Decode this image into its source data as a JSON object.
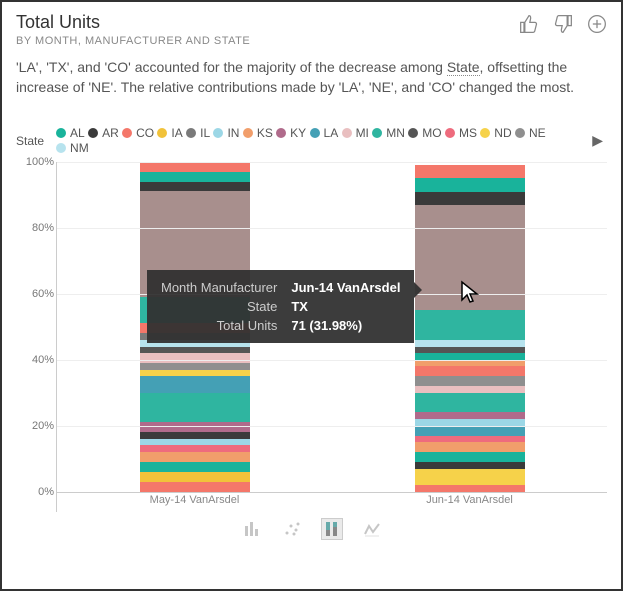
{
  "header": {
    "title": "Total Units",
    "subtitle": "BY MONTH, MANUFACTURER AND STATE"
  },
  "insight": {
    "pre": "'LA', 'TX', and 'CO' accounted for the majority of the decrease among ",
    "link": "State",
    "post": ", offsetting the increase of 'NE'. The relative contributions made by 'LA', 'NE', and 'CO' changed the most."
  },
  "legend": {
    "label": "State",
    "items": [
      {
        "name": "AL",
        "color": "#19b39b"
      },
      {
        "name": "AR",
        "color": "#3a3a3a"
      },
      {
        "name": "CO",
        "color": "#f4776a"
      },
      {
        "name": "IA",
        "color": "#f1c23a"
      },
      {
        "name": "IL",
        "color": "#7a7a7a"
      },
      {
        "name": "IN",
        "color": "#9cd7e6"
      },
      {
        "name": "KS",
        "color": "#f19e6b"
      },
      {
        "name": "KY",
        "color": "#b06b8b"
      },
      {
        "name": "LA",
        "color": "#44a0b5"
      },
      {
        "name": "MI",
        "color": "#e9bfc0"
      },
      {
        "name": "MN",
        "color": "#2fb5a0"
      },
      {
        "name": "MO",
        "color": "#555555"
      },
      {
        "name": "MS",
        "color": "#ee6b7d"
      },
      {
        "name": "ND",
        "color": "#f6d24a"
      },
      {
        "name": "NE",
        "color": "#8f8f8f"
      },
      {
        "name": "NM",
        "color": "#b7e3ee"
      }
    ]
  },
  "tooltip": {
    "k1": "Month Manufacturer",
    "v1": "Jun-14 VanArsdel",
    "k2": "State",
    "v2": "TX",
    "k3": "Total Units",
    "v3": "71 (31.98%)"
  },
  "viewbuttons": {
    "active_index": 2
  },
  "chart_data": {
    "type": "bar",
    "stacked": "100%",
    "ylabel": "",
    "xlabel": "",
    "ylim": [
      0,
      100
    ],
    "y_ticks": [
      "0%",
      "20%",
      "40%",
      "60%",
      "80%",
      "100%"
    ],
    "categories": [
      "May-14 VanArsdel",
      "Jun-14 VanArsdel"
    ],
    "legend_dimension": "State",
    "series_listed": [
      "AL",
      "AR",
      "CO",
      "IA",
      "IL",
      "IN",
      "KS",
      "KY",
      "LA",
      "MI",
      "MN",
      "MO",
      "MS",
      "ND",
      "NE",
      "NM"
    ],
    "segments": [
      [
        {
          "color": "#f4776a",
          "pct": 3.0
        },
        {
          "color": "#f1c23a",
          "pct": 3.0
        },
        {
          "color": "#19b39b",
          "pct": 3.0
        },
        {
          "color": "#f19e6b",
          "pct": 3.0
        },
        {
          "color": "#ee6b7d",
          "pct": 2.0
        },
        {
          "color": "#9cd7e6",
          "pct": 2.0
        },
        {
          "color": "#3a3a3a",
          "pct": 2.0
        },
        {
          "color": "#b06b8b",
          "pct": 3.0
        },
        {
          "color": "#2fb5a0",
          "pct": 9.0
        },
        {
          "color": "#44a0b5",
          "pct": 5.0
        },
        {
          "color": "#f6d24a",
          "pct": 2.0
        },
        {
          "color": "#8f8f8f",
          "pct": 2.0
        },
        {
          "color": "#e9bfc0",
          "pct": 3.0
        },
        {
          "color": "#555555",
          "pct": 2.0
        },
        {
          "color": "#b7e3ee",
          "pct": 2.0
        },
        {
          "color": "#7a7a7a",
          "pct": 2.0
        },
        {
          "color": "#f4776a",
          "pct": 3.0
        },
        {
          "color": "#2fb5a0",
          "pct": 8.0
        },
        {
          "color": "#a88f8d",
          "pct": 32.0
        },
        {
          "color": "#3a3a3a",
          "pct": 3.0
        },
        {
          "color": "#19b39b",
          "pct": 3.0
        },
        {
          "color": "#f4776a",
          "pct": 3.0
        }
      ],
      [
        {
          "color": "#f4776a",
          "pct": 2.0
        },
        {
          "color": "#f6d24a",
          "pct": 5.0
        },
        {
          "color": "#3a3a3a",
          "pct": 2.0
        },
        {
          "color": "#19b39b",
          "pct": 3.0
        },
        {
          "color": "#f19e6b",
          "pct": 3.0
        },
        {
          "color": "#ee6b7d",
          "pct": 2.0
        },
        {
          "color": "#44a0b5",
          "pct": 3.0
        },
        {
          "color": "#9cd7e6",
          "pct": 2.0
        },
        {
          "color": "#b06b8b",
          "pct": 2.0
        },
        {
          "color": "#2fb5a0",
          "pct": 6.0
        },
        {
          "color": "#e9bfc0",
          "pct": 2.0
        },
        {
          "color": "#8f8f8f",
          "pct": 3.0
        },
        {
          "color": "#f4776a",
          "pct": 3.0
        },
        {
          "color": "#f19e6b",
          "pct": 2.0
        },
        {
          "color": "#19b39b",
          "pct": 2.0
        },
        {
          "color": "#555555",
          "pct": 2.0
        },
        {
          "color": "#b7e3ee",
          "pct": 2.0
        },
        {
          "color": "#2fb5a0",
          "pct": 9.0
        },
        {
          "color": "#a88f8d",
          "pct": 31.98
        },
        {
          "color": "#3a3a3a",
          "pct": 4.0
        },
        {
          "color": "#19b39b",
          "pct": 4.0
        },
        {
          "color": "#f4776a",
          "pct": 4.0
        }
      ]
    ],
    "tooltip_sample": {
      "category": "Jun-14 VanArsdel",
      "state": "TX",
      "value": 71,
      "percent": 31.98
    }
  }
}
